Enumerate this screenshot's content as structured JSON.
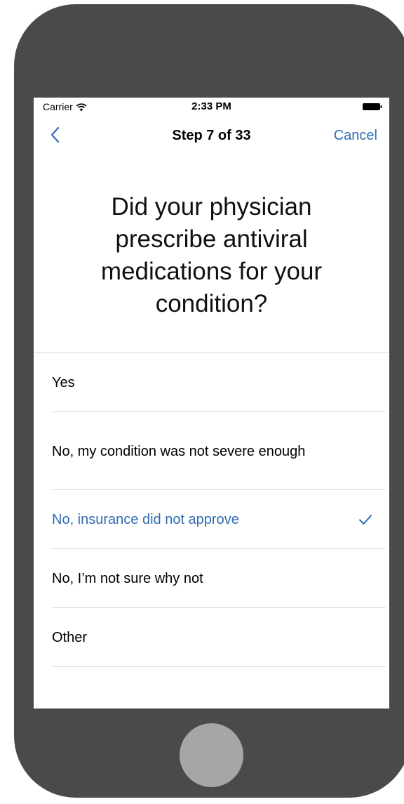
{
  "status_bar": {
    "carrier": "Carrier",
    "time": "2:33 PM"
  },
  "nav": {
    "title": "Step 7 of 33",
    "cancel_label": "Cancel",
    "back_icon": "chevron-left-icon"
  },
  "question": "Did your physician prescribe antiviral medications for your condition?",
  "options": [
    {
      "label": "Yes",
      "selected": false
    },
    {
      "label": "No, my condition was not severe enough",
      "selected": false
    },
    {
      "label": "No, insurance did not approve",
      "selected": true
    },
    {
      "label": "No, I’m not sure why not",
      "selected": false
    },
    {
      "label": "Other",
      "selected": false
    }
  ],
  "colors": {
    "accent": "#2f6cb5",
    "device_body": "#4a4a4a",
    "home_button": "#a6a6a6",
    "separator": "#d9d9d9"
  }
}
